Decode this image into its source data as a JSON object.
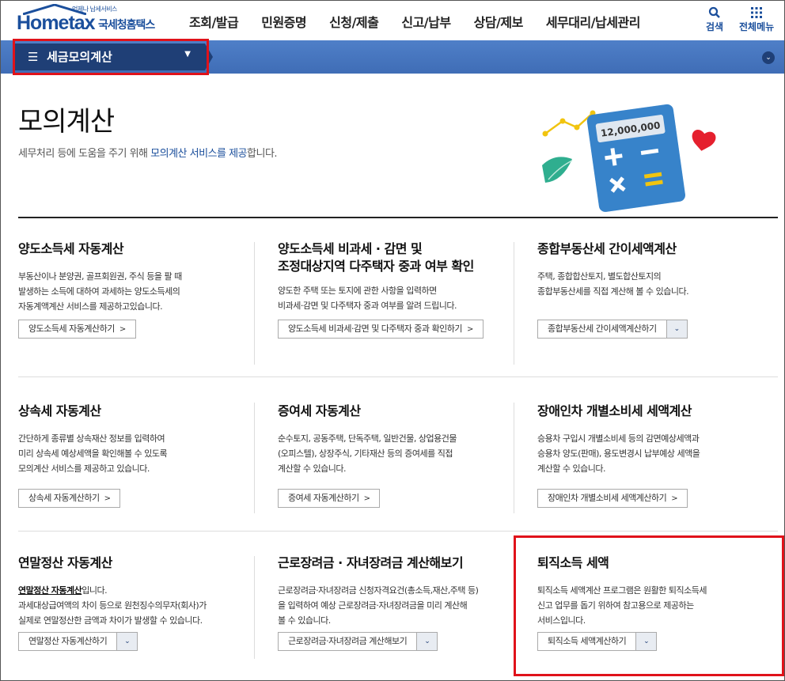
{
  "header": {
    "logo_sub": "언제나 납세서비스",
    "logo_main": "Hometax",
    "logo_kr": "국세청홈택스",
    "nav": [
      "조회/발급",
      "민원증명",
      "신청/제출",
      "신고/납부",
      "상담/제보",
      "세무대리/납세관리"
    ],
    "search_label": "검색",
    "all_menu_label": "전체메뉴"
  },
  "band": {
    "menu_label": "세금모의계산"
  },
  "hero": {
    "title": "모의계산",
    "desc_pre": "세무처리 등에 도움을 주기 위해 ",
    "desc_hl": "모의계산 서비스를 제공",
    "desc_post": "합니다.",
    "calc_value": "12,000,000"
  },
  "cards": [
    {
      "title": "양도소득세 자동계산",
      "desc": [
        "부동산이나 분양권, 골프회원권, 주식 등을 팔 때",
        "발생하는 소득에 대하여 과세하는 양도소득세의",
        "자동계액계산 서비스를 제공하고있습니다."
      ],
      "button": "양도소득세 자동계산하기"
    },
    {
      "title_lines": [
        "양도소득세 비과세 · 감면 및",
        "조정대상지역 다주택자 중과 여부 확인"
      ],
      "desc": [
        "양도한 주택 또는 토지에 관한 사항을 입력하면",
        "비과세·감면 및 다주택자 중과 여부를 알려 드립니다."
      ],
      "button": "양도소득세 비과세·감면 및 다주택자 중과 확인하기"
    },
    {
      "title": "종합부동산세 간이세액계산",
      "desc": [
        "주택, 종합합산토지, 별도합산토지의",
        "종합부동산세를 직접 계산해 볼 수 있습니다."
      ],
      "button": "종합부동산세 간이세액계산하기"
    },
    {
      "title": "상속세 자동계산",
      "desc": [
        "간단하게 종류별 상속재산 정보를 입력하여",
        "미리 상속세 예상세액을 확인해볼 수 있도록",
        "모의계산 서비스를 제공하고 있습니다."
      ],
      "button": "상속세 자동계산하기"
    },
    {
      "title": "증여세 자동계산",
      "desc": [
        "순수토지, 공동주택, 단독주택, 일반건물, 상업용건물",
        "(오피스텔), 상장주식, 기타재산 등의 증여세를 직접",
        "계산할 수 있습니다."
      ],
      "button": "증여세 자동계산하기"
    },
    {
      "title": "장애인차 개별소비세 세액계산",
      "desc": [
        "승용차 구입시 개별소비세 등의 감면예상세액과",
        "승용차 양도(판매), 용도변경시 납부예상 세액을",
        "계산할 수 있습니다."
      ],
      "button": "장애인차 개별소비세 세액계산하기"
    },
    {
      "title": "연말정산 자동계산",
      "desc_bold": "연말정산 자동계산",
      "desc_first_post": "입니다.",
      "desc": [
        "과세대상급여액의 차이 등으로 원천징수의무자(회사)가",
        "실제로 연말정산한 금액과 차이가 발생할 수 있습니다."
      ],
      "button": "연말정산 자동계산하기"
    },
    {
      "title": "근로장려금 · 자녀장려금 계산해보기",
      "desc": [
        "근로장려금·자녀장려금 신청자격요건(총소득,재산,주택 등)",
        "을 입력하여 예상 근로장려금·자녀장려금을 미리 계산해",
        "볼 수 있습니다."
      ],
      "button": "근로장려금·자녀장려금 계산해보기"
    },
    {
      "title": "퇴직소득 세액",
      "desc": [
        "퇴직소득 세액계산 프로그램은 원활한 퇴직소득세",
        "신고 업무를 돕기 위하여 참고용으로 제공하는",
        "서비스입니다."
      ],
      "button": "퇴직소득 세액계산하기"
    }
  ],
  "colors": {
    "brand": "#1b4f9c",
    "band": "#4f7fc8",
    "menu_dark": "#1f3f76",
    "highlight": "#e0121a"
  },
  "icons": [
    "search-icon",
    "grid-menu-icon",
    "hamburger-icon",
    "caret-down-icon",
    "chevron-right-icon",
    "calculator-icon",
    "heart-icon"
  ]
}
